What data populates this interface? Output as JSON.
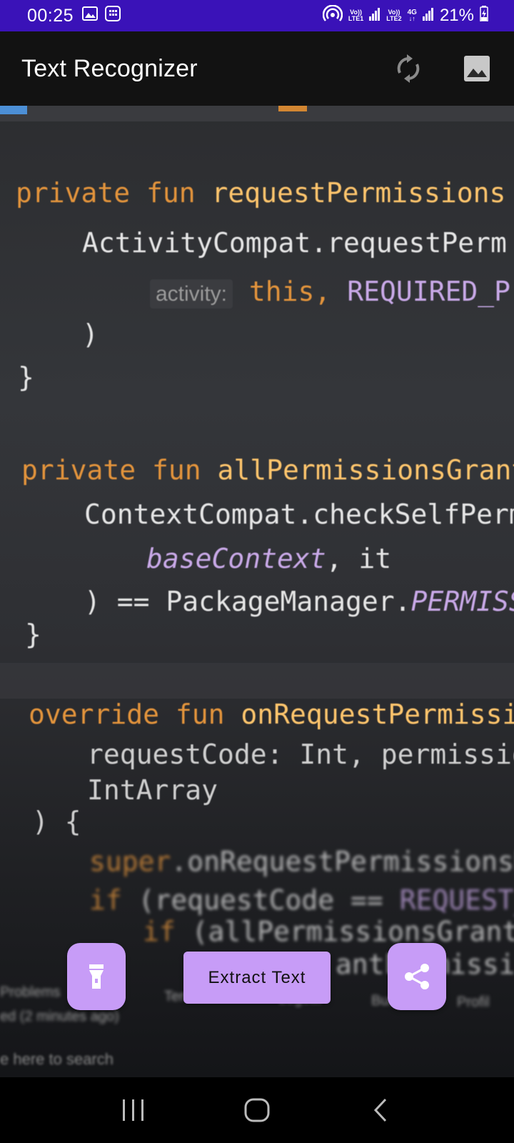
{
  "status_bar": {
    "time": "00:25",
    "sim1_label_top": "Vo))",
    "sim1_label_bottom": "LTE1",
    "sim2_label_top": "Vo))",
    "sim2_label_bottom": "LTE2",
    "network": "4G",
    "battery": "21%",
    "icons": [
      "image-icon",
      "calendar-icon",
      "hotspot-icon",
      "signal-icon",
      "battery-charging-icon"
    ]
  },
  "app_bar": {
    "title": "Text Recognizer",
    "actions": [
      "refresh-icon",
      "gallery-icon"
    ]
  },
  "camera_preview": {
    "lines": {
      "l1_kw": "private fun ",
      "l1_fn": "requestPermissions",
      "l2": "ActivityCompat.requestPerm",
      "l3_param": "activity:",
      "l3_a": " this, ",
      "l3_b": "REQUIRED_P",
      "l4": ")",
      "l5": "}",
      "l6_kw": "private fun ",
      "l6_fn": "allPermissionsGrante",
      "l7": "ContextCompat.checkSelfPermi",
      "l8_it": "baseContext",
      "l8_b": ", it",
      "l9_a": ") == PackageManager.",
      "l9_it": "PERMISSIO",
      "l10": "}",
      "l11_kw": "override fun ",
      "l11_fn": "onRequestPermissions",
      "l12": "requestCode: Int, permissions.",
      "l13": "IntArray",
      "l14": ") {",
      "l15_kw": "super",
      "l15_b": ".onRequestPermissionsResu",
      "l16_kw": "if ",
      "l16_b": "(requestCode == ",
      "l16_it": "REQUEST_CODE",
      "l17_kw": "if ",
      "l17_b": "(allPermissionsGranted()",
      "l18_b": "antPermissio",
      "tools_1": "Problems",
      "tools_2": "Terminal",
      "tools_3": "Logcat",
      "tools_4": "Build",
      "tools_5": "Profil",
      "status_1": "ed (2 minutes ago)",
      "status_2": "e here to search"
    }
  },
  "buttons": {
    "flashlight": "flashlight-icon",
    "extract_label": "Extract Text",
    "share": "share-icon"
  },
  "nav_bar": {
    "items": [
      "recents-icon",
      "home-icon",
      "back-icon"
    ]
  }
}
